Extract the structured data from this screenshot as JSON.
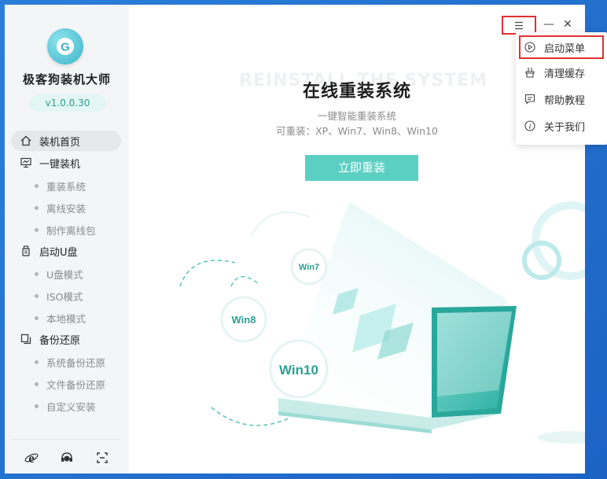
{
  "app": {
    "name": "极客狗装机大师",
    "version": "v1.0.0.30"
  },
  "sidebar": {
    "groups": [
      {
        "label": "装机首页",
        "icon": "home-icon",
        "active": true,
        "items": []
      },
      {
        "label": "一键装机",
        "icon": "monitor-icon",
        "items": [
          "重装系统",
          "离线安装",
          "制作离线包"
        ]
      },
      {
        "label": "启动U盘",
        "icon": "usb-icon",
        "items": [
          "U盘模式",
          "ISO模式",
          "本地模式"
        ]
      },
      {
        "label": "备份还原",
        "icon": "backup-icon",
        "items": [
          "系统备份还原",
          "文件备份还原",
          "自定义安装"
        ]
      }
    ],
    "bottom_icons": [
      "ie-browser-icon",
      "chat-support-icon",
      "expand-icon"
    ]
  },
  "main": {
    "watermark": "REINSTALL THE SYSTEM",
    "title": "在线重装系统",
    "subtitle": "一键智能重装系统",
    "systems": "可重装：XP、Win7、Win8、Win10",
    "install_button": "立即重装",
    "badges": [
      "Win7",
      "Win8",
      "Win10"
    ]
  },
  "window_controls": {
    "menu_icon": "hamburger-menu-icon",
    "minimize": "—",
    "close": "✕"
  },
  "dropdown": {
    "items": [
      {
        "label": "启动菜单",
        "icon": "play-circle-icon"
      },
      {
        "label": "清理缓存",
        "icon": "broom-icon"
      },
      {
        "label": "帮助教程",
        "icon": "help-chat-icon"
      },
      {
        "label": "关于我们",
        "icon": "info-icon"
      }
    ]
  },
  "colors": {
    "accent": "#5ccfc3",
    "highlight_border": "#e0322e",
    "desktop_bg": "#1c63c4"
  }
}
